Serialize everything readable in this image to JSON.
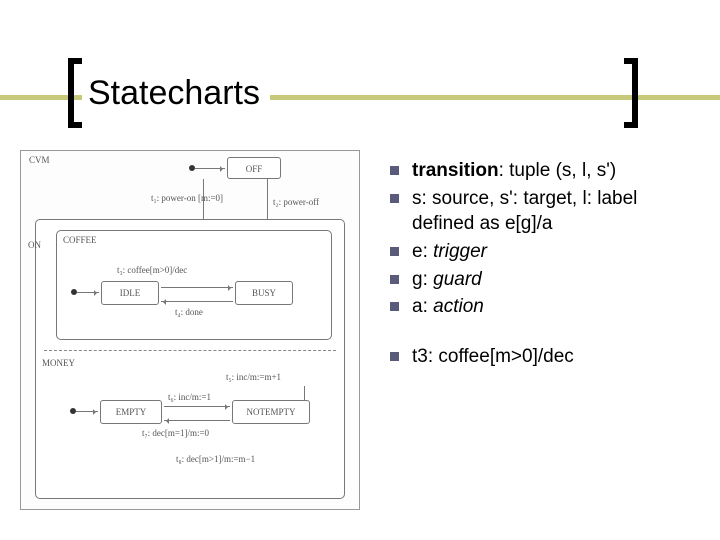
{
  "title": "Statecharts",
  "bullets": {
    "b1_pre": "transition",
    "b1_post": ": tuple (s, l, s')",
    "b2": "s: source, s': target, l: label defined as e[g]/a",
    "b3_pre": "e: ",
    "b3_it": "trigger",
    "b4_pre": "g: ",
    "b4_it": "guard",
    "b5_pre": "a: ",
    "b5_it": "action",
    "b6": "t3: coffee[m>0]/dec"
  },
  "diagram": {
    "outer": "CVM",
    "off": "OFF",
    "on": "ON",
    "coffee": "COFFEE",
    "idle": "IDLE",
    "busy": "BUSY",
    "money": "MONEY",
    "empty": "EMPTY",
    "notempty": "NOTEMPTY",
    "t1": "t₁: power-on [m:=0]",
    "t2": "t₂: power-off",
    "t3": "t₃: coffee[m>0]/dec",
    "t4": "t₄: done",
    "t5": "t₅: inc/m:=m+1",
    "t6": "t₆: inc/m:=1",
    "t7": "t₇: dec[m=1]/m:=0",
    "t8": "t₈: dec[m>1]/m:=m−1"
  }
}
